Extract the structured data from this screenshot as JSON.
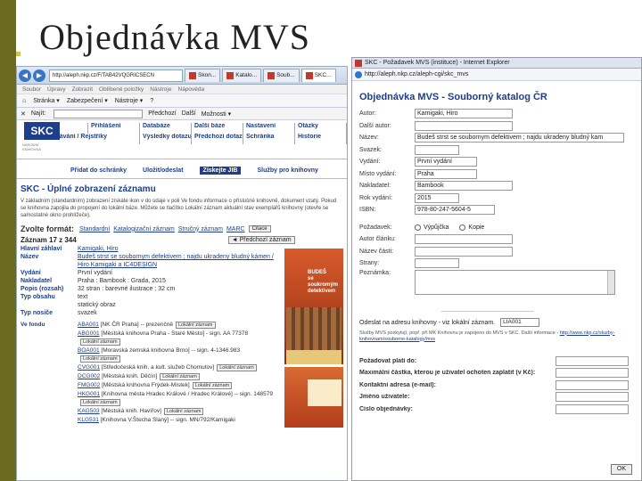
{
  "slide": {
    "title": "Objednávka MVS"
  },
  "left_browser": {
    "url": "http://aleph.nkp.cz/F/TAB42VQGRICSECN",
    "tabs": [
      "Skon...",
      "Katalo...",
      "Soub...",
      "SKC..."
    ],
    "menu": [
      "Soubor",
      "Úpravy",
      "Zobrazit",
      "Oblíbené položky",
      "Nástroje",
      "Nápověda"
    ],
    "cmd": [
      "Stránka ▾",
      "Zabezpečení ▾",
      "Nástroje ▾",
      "?"
    ],
    "find": {
      "label": "Najít:",
      "prev": "Předchozí",
      "next": "Další",
      "options": "Možnosti ▾"
    },
    "skc_nav_row1": [
      "Konec",
      "Přihlášení",
      "Databáze",
      "Další báze",
      "Nastavení",
      "Otázky"
    ],
    "skc_nav_row2": [
      "Vyhledávání / Rejstříky",
      "Výsledky dotazu",
      "Předchozí dotazy",
      "Schránka",
      "Historie"
    ],
    "toolbar": [
      "Přidat do schránky",
      "Uložit/odeslat",
      "Získejte JIB",
      "Služby pro knihovny"
    ],
    "record_title": "SKC - Úplné zobrazení záznamu",
    "record_desc": "V základním (standardním) zobrazení získáte ikon v do údaje v poli Ve fondu informace o příslušné knihovně, dokument vzatý. Pokud se knihovna zapojila do propojení do lokální báze. Můžete se tlačítko Lokální záznam aktuální stav exemplářů knihovny (otevře se samostatné okno prohlížeče).",
    "format_label": "Zvolte formát:",
    "formats": [
      "Standardní",
      "Katalogizační záznam",
      "Stručný záznam",
      "MARC"
    ],
    "format_button": "Citace",
    "record_count": "Záznam 17 z 344",
    "prev_button": "◄ Předchozí záznam",
    "fields": [
      {
        "k": "Hlavní záhlaví",
        "v": "Kamigaki, Hiro"
      },
      {
        "k": "Název",
        "v": "Budeš strst se soubornym defektivem ; najdu ukradeny bludný kámen / Hiro Kamigaki a IC4DESIGN"
      },
      {
        "k": "Vydání",
        "v": "První vydání"
      },
      {
        "k": "Nakladatel",
        "v": "Praha : Bambook : Grada, 2015"
      },
      {
        "k": "Popis (rozsah)",
        "v": "32 stran : barevné ilustrace ; 32 cm"
      },
      {
        "k": "Typ obsahu",
        "v": "text"
      },
      {
        "k": "",
        "v": "statický obraz"
      },
      {
        "k": "Typ nosiče",
        "v": "svazek"
      }
    ],
    "holdings_label": "Ve fondu",
    "holdings": [
      {
        "sig": "ABA001",
        "text": "[NK ČR Praha] -- prezenčně"
      },
      {
        "sig": "ABG001",
        "text": "[Městská knihovna Praha - Staré Město] - sign. AA 77378"
      },
      {
        "sig": "BOA001",
        "text": "[Moravská zemská knihovna Brno] -- sign. 4-1346.983"
      },
      {
        "sig": "CVG001",
        "text": "[Středočeská knih. a kult. služeb Chomutov]"
      },
      {
        "sig": "DCG002",
        "text": "[Městská knih. Děčín]"
      },
      {
        "sig": "FMG002",
        "text": "[Městská knihovna Frýdek-Místek]"
      },
      {
        "sig": "HKG001",
        "text": "[Knihovna města Hradec Králové / Hradec Králové] -- sign. 148579"
      },
      {
        "sig": "KAG503",
        "text": "[Městská knih. Havířov]"
      },
      {
        "sig": "KLG531",
        "text": "[Knihovna V.Štecha Slaný] -- sign. MN/792/Kamigaki"
      }
    ],
    "local_record_label": "Lokální záznam"
  },
  "right_browser": {
    "title": "SKC - Požadavek MVS (instituce) - Internet Explorer",
    "url": "http://aleph.nkp.cz/aleph-cgi/skc_mvs",
    "form_title": "Objednávka MVS - Souborný katalog ČR",
    "fields": [
      {
        "label": "Autor:",
        "value": "Kamigaki, Hiro"
      },
      {
        "label": "Další autor:",
        "value": ""
      },
      {
        "label": "Název:",
        "value": "Budeš strst se soubornym defektivem ; najdu ukradeny bludný kam"
      },
      {
        "label": "Svazek:",
        "value": ""
      },
      {
        "label": "Vydání:",
        "value": "První vydání"
      },
      {
        "label": "Místo vydání:",
        "value": "Praha"
      },
      {
        "label": "Nakladatel:",
        "value": "Bambook"
      },
      {
        "label": "Rok vydání:",
        "value": "2015"
      },
      {
        "label": "ISBN:",
        "value": "978-80-247-5604-5"
      }
    ],
    "request_label": "Požadavek:",
    "request_options": [
      "Výpůjčka",
      "Kopie"
    ],
    "article_fields": [
      "Autor článku:",
      "Název části:",
      "Strany:"
    ],
    "note_label": "Poznámka:",
    "send_label": "Odeslat na adresu knihovny - viz lokální záznam.",
    "send_value": "LIA001",
    "small_note": "Služby MVS poskytují, popř. při MK Knihovnu je zapojeno do MVS v SKC. Další informace -",
    "small_note_link": "http://www.nkp.cz/sluzby-knihovnam/souborne-katalogy/mvs",
    "bottom_fields": [
      "Požadovat platí do:",
      "Maximální částka, kterou je uživatel ochoten zaplatit (v Kč):",
      "Kontaktní adresa (e-mail):",
      "Jméno uživatele:",
      "Číslo objednávky:"
    ],
    "ok_button": "OK"
  }
}
